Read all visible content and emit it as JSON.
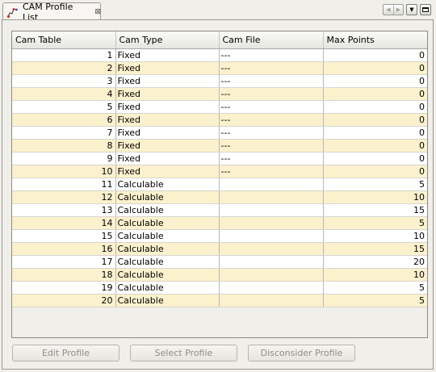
{
  "tab": {
    "title": "CAM Profile List",
    "icon": "cam-profile-icon",
    "close_glyph": "⊠"
  },
  "view_controls": {
    "back_glyph": "◀",
    "forward_glyph": "▶",
    "menu_glyph": "▼"
  },
  "table": {
    "columns": [
      "Cam Table",
      "Cam Type",
      "Cam File",
      "Max Points"
    ],
    "rows": [
      {
        "cam_table": "1",
        "cam_type": "Fixed",
        "cam_file": "---",
        "max_points": "0"
      },
      {
        "cam_table": "2",
        "cam_type": "Fixed",
        "cam_file": "---",
        "max_points": "0"
      },
      {
        "cam_table": "3",
        "cam_type": "Fixed",
        "cam_file": "---",
        "max_points": "0"
      },
      {
        "cam_table": "4",
        "cam_type": "Fixed",
        "cam_file": "---",
        "max_points": "0"
      },
      {
        "cam_table": "5",
        "cam_type": "Fixed",
        "cam_file": "---",
        "max_points": "0"
      },
      {
        "cam_table": "6",
        "cam_type": "Fixed",
        "cam_file": "---",
        "max_points": "0"
      },
      {
        "cam_table": "7",
        "cam_type": "Fixed",
        "cam_file": "---",
        "max_points": "0"
      },
      {
        "cam_table": "8",
        "cam_type": "Fixed",
        "cam_file": "---",
        "max_points": "0"
      },
      {
        "cam_table": "9",
        "cam_type": "Fixed",
        "cam_file": "---",
        "max_points": "0"
      },
      {
        "cam_table": "10",
        "cam_type": "Fixed",
        "cam_file": "---",
        "max_points": "0"
      },
      {
        "cam_table": "11",
        "cam_type": "Calculable",
        "cam_file": "",
        "max_points": "5"
      },
      {
        "cam_table": "12",
        "cam_type": "Calculable",
        "cam_file": "",
        "max_points": "10"
      },
      {
        "cam_table": "13",
        "cam_type": "Calculable",
        "cam_file": "",
        "max_points": "15"
      },
      {
        "cam_table": "14",
        "cam_type": "Calculable",
        "cam_file": "",
        "max_points": "5"
      },
      {
        "cam_table": "15",
        "cam_type": "Calculable",
        "cam_file": "",
        "max_points": "10"
      },
      {
        "cam_table": "16",
        "cam_type": "Calculable",
        "cam_file": "",
        "max_points": "15"
      },
      {
        "cam_table": "17",
        "cam_type": "Calculable",
        "cam_file": "",
        "max_points": "20"
      },
      {
        "cam_table": "18",
        "cam_type": "Calculable",
        "cam_file": "",
        "max_points": "10"
      },
      {
        "cam_table": "19",
        "cam_type": "Calculable",
        "cam_file": "",
        "max_points": "5"
      },
      {
        "cam_table": "20",
        "cam_type": "Calculable",
        "cam_file": "",
        "max_points": "5"
      }
    ]
  },
  "buttons": {
    "edit_profile": "Edit Profile",
    "select_profile": "Select Profile",
    "disconsider_profile": "Disconsider Profile"
  },
  "colors": {
    "row_even": "#ffffff",
    "row_odd": "#fbf1cd",
    "background": "#f0efea",
    "disabled_text": "#8e8d88"
  }
}
